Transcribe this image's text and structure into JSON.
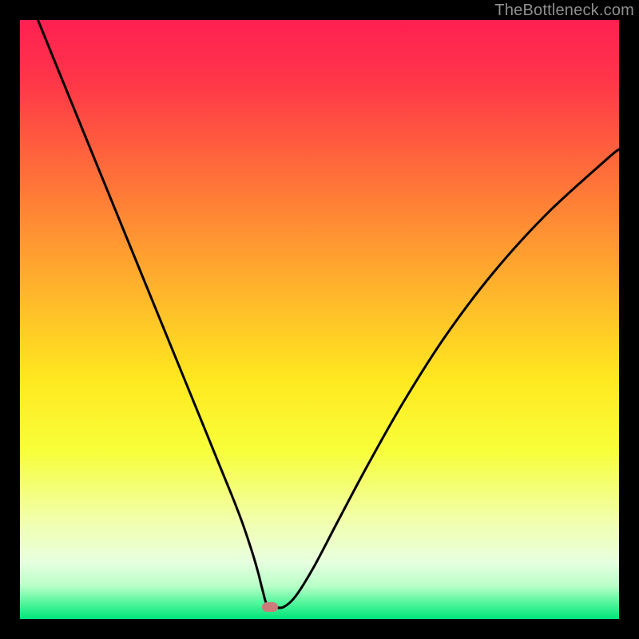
{
  "watermark": {
    "text": "TheBottleneck.com"
  },
  "chart_data": {
    "type": "line",
    "title": "",
    "xlabel": "",
    "ylabel": "",
    "xlim": [
      0,
      100
    ],
    "ylim": [
      0,
      100
    ],
    "grid": false,
    "legend": false,
    "background_gradient": {
      "stops": [
        {
          "pos": 0.0,
          "color": "#ff2052"
        },
        {
          "pos": 0.1,
          "color": "#ff3549"
        },
        {
          "pos": 0.25,
          "color": "#ff6c3a"
        },
        {
          "pos": 0.45,
          "color": "#ffb42c"
        },
        {
          "pos": 0.6,
          "color": "#ffe81f"
        },
        {
          "pos": 0.72,
          "color": "#f7ff3a"
        },
        {
          "pos": 0.84,
          "color": "#f1ffb0"
        },
        {
          "pos": 0.905,
          "color": "#e8ffe0"
        },
        {
          "pos": 0.945,
          "color": "#b8ffc8"
        },
        {
          "pos": 0.975,
          "color": "#4cf59a"
        },
        {
          "pos": 1.0,
          "color": "#00e47a"
        }
      ]
    },
    "series": [
      {
        "name": "bottleneck-curve",
        "x": [
          3,
          6,
          10,
          14,
          18,
          22,
          26,
          30,
          33.5,
          35.5,
          37,
          38,
          39,
          39.8,
          40.5,
          41.3,
          42.5,
          44,
          46,
          49,
          53,
          58,
          64,
          71,
          79,
          88,
          98,
          100
        ],
        "y": [
          100,
          92.6,
          82.8,
          73.0,
          63.2,
          53.4,
          43.6,
          33.8,
          25.2,
          20.3,
          16.4,
          13.5,
          10.4,
          7.6,
          4.8,
          2.2,
          2.0,
          2.0,
          3.8,
          8.6,
          16.2,
          25.6,
          36.2,
          47.2,
          57.8,
          67.7,
          76.8,
          78.4
        ]
      }
    ],
    "annotations": [
      {
        "name": "min-marker",
        "x": 41.7,
        "y": 2.0,
        "shape": "pill",
        "color": "#cd7a7b"
      }
    ]
  }
}
